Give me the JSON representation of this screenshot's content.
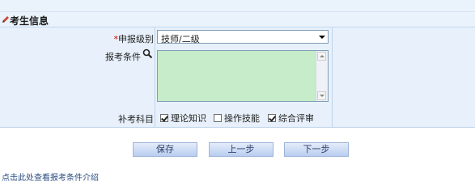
{
  "section": {
    "title": "考生信息"
  },
  "form": {
    "level": {
      "required_mark": "*",
      "label": "申报级别",
      "value": "技师/二级"
    },
    "conditions": {
      "label": "报考条件",
      "value": ""
    },
    "subjects": {
      "label": "补考科目",
      "options": [
        {
          "label": "理论知识",
          "checked": true
        },
        {
          "label": "操作技能",
          "checked": false
        },
        {
          "label": "综合评审",
          "checked": true
        }
      ]
    }
  },
  "buttons": {
    "save": "保存",
    "prev": "上一步",
    "next": "下一步"
  },
  "link": {
    "text": "点击此处查看报考条件介绍"
  }
}
